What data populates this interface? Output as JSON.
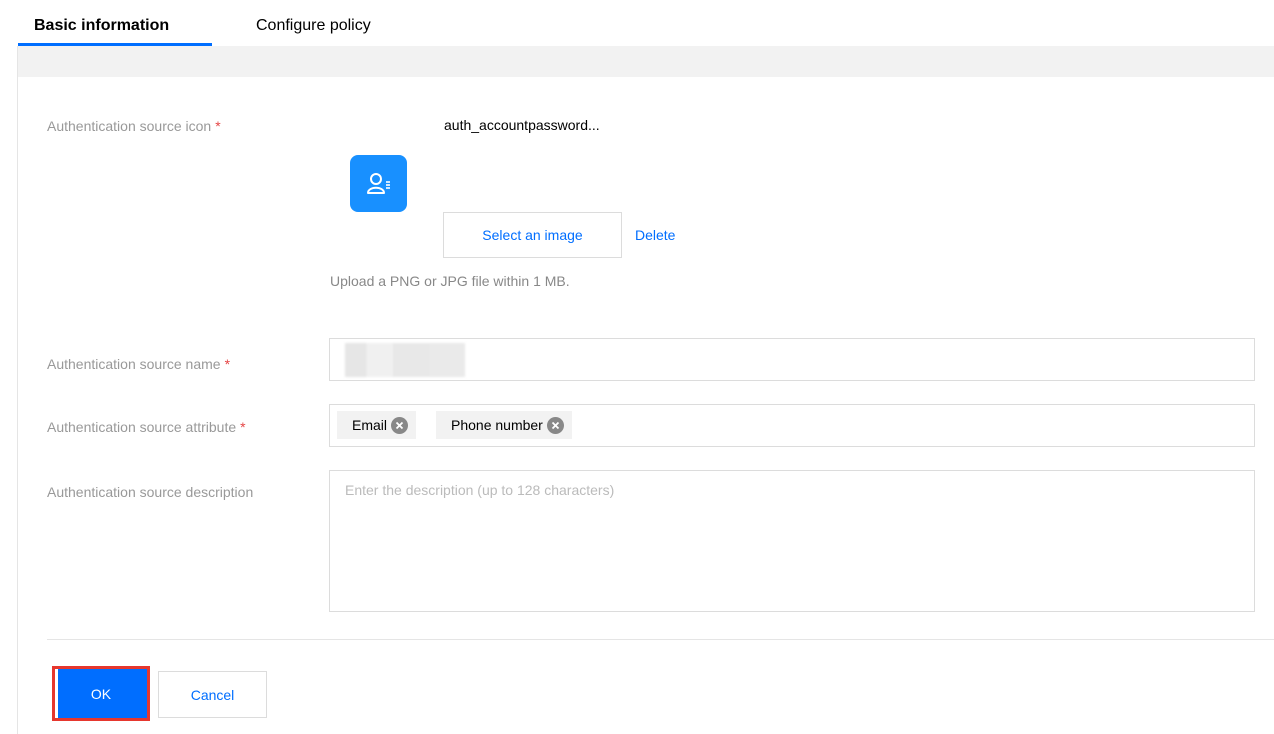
{
  "tabs": [
    {
      "label": "Basic information",
      "active": true
    },
    {
      "label": "Configure policy",
      "active": false
    }
  ],
  "form": {
    "icon_label": "Authentication source icon",
    "required_mark": "*",
    "icon_file_name": "auth_accountpassword...",
    "icon_name": "user-list-icon",
    "select_image_label": "Select an image",
    "delete_label": "Delete",
    "upload_hint": "Upload a PNG or JPG file within 1 MB.",
    "name_label": "Authentication source name",
    "attribute_label": "Authentication source attribute",
    "attribute_tags": [
      "Email",
      "Phone number"
    ],
    "description_label": "Authentication source description",
    "description_placeholder": "Enter the description (up to 128 characters)"
  },
  "actions": {
    "ok_label": "OK",
    "cancel_label": "Cancel"
  },
  "colors": {
    "accent": "#006eff",
    "required": "#e54545",
    "highlight": "#e6372e"
  }
}
